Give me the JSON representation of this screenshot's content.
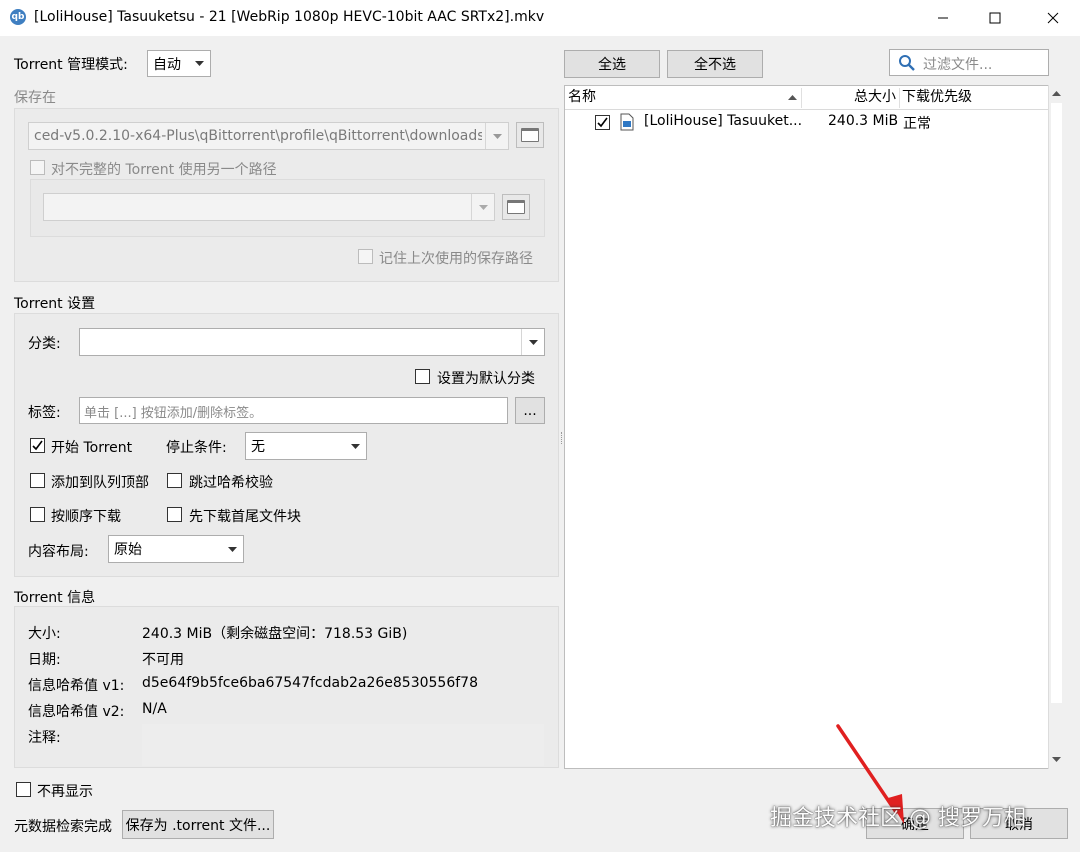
{
  "window": {
    "title": "[LoliHouse] Tasuuketsu - 21 [WebRip 1080p HEVC-10bit AAC SRTx2].mkv",
    "app_icon_label": "qb"
  },
  "left": {
    "mode_label": "Torrent 管理模式:",
    "mode_value": "自动",
    "save_in_label": "保存在",
    "save_path": "ced-v5.0.2.10-x64-Plus\\qBittorrent\\profile\\qBittorrent\\downloads",
    "use_other_path_label": "对不完整的 Torrent 使用另一个路径",
    "other_path_value": "",
    "remember_path_label": "记住上次使用的保存路径",
    "settings_title": "Torrent 设置",
    "category_label": "分类:",
    "category_value": "",
    "default_category_label": "设置为默认分类",
    "tags_label": "标签:",
    "tags_placeholder": "单击 [...] 按钮添加/删除标签。",
    "tags_button": "...",
    "start_torrent_label": "开始 Torrent",
    "stop_condition_label": "停止条件:",
    "stop_condition_value": "无",
    "add_to_top_label": "添加到队列顶部",
    "skip_hash_label": "跳过哈希校验",
    "sequential_label": "按顺序下载",
    "first_last_label": "先下载首尾文件块",
    "layout_label": "内容布局:",
    "layout_value": "原始",
    "info_title": "Torrent 信息",
    "info": {
      "size_label": "大小:",
      "size_value": "240.3 MiB（剩余磁盘空间：718.53 GiB)",
      "date_label": "日期:",
      "date_value": "不可用",
      "hash1_label": "信息哈希值 v1:",
      "hash1_value": "d5e64f9b5fce6ba67547fcdab2a26e8530556f78",
      "hash2_label": "信息哈希值 v2:",
      "hash2_value": "N/A",
      "comment_label": "注释:"
    }
  },
  "right": {
    "select_all": "全选",
    "select_none": "全不选",
    "filter_placeholder": "过滤文件...",
    "columns": [
      "名称",
      "总大小",
      "下载优先级"
    ],
    "files": [
      {
        "name": "[LoliHouse] Tasuuket...",
        "size": "240.3 MiB",
        "priority": "正常",
        "checked": true
      }
    ]
  },
  "bottom": {
    "dont_show_label": "不再显示",
    "metadata_status": "元数据检索完成",
    "save_torrent_button": "保存为 .torrent 文件...",
    "ok_button": "确定",
    "cancel_button": "取消"
  },
  "watermark": "掘金技术社区 @ 搜罗万相",
  "colors": {
    "accent_blue": "#3f7fc1",
    "annotation_arrow": "#e02020"
  }
}
